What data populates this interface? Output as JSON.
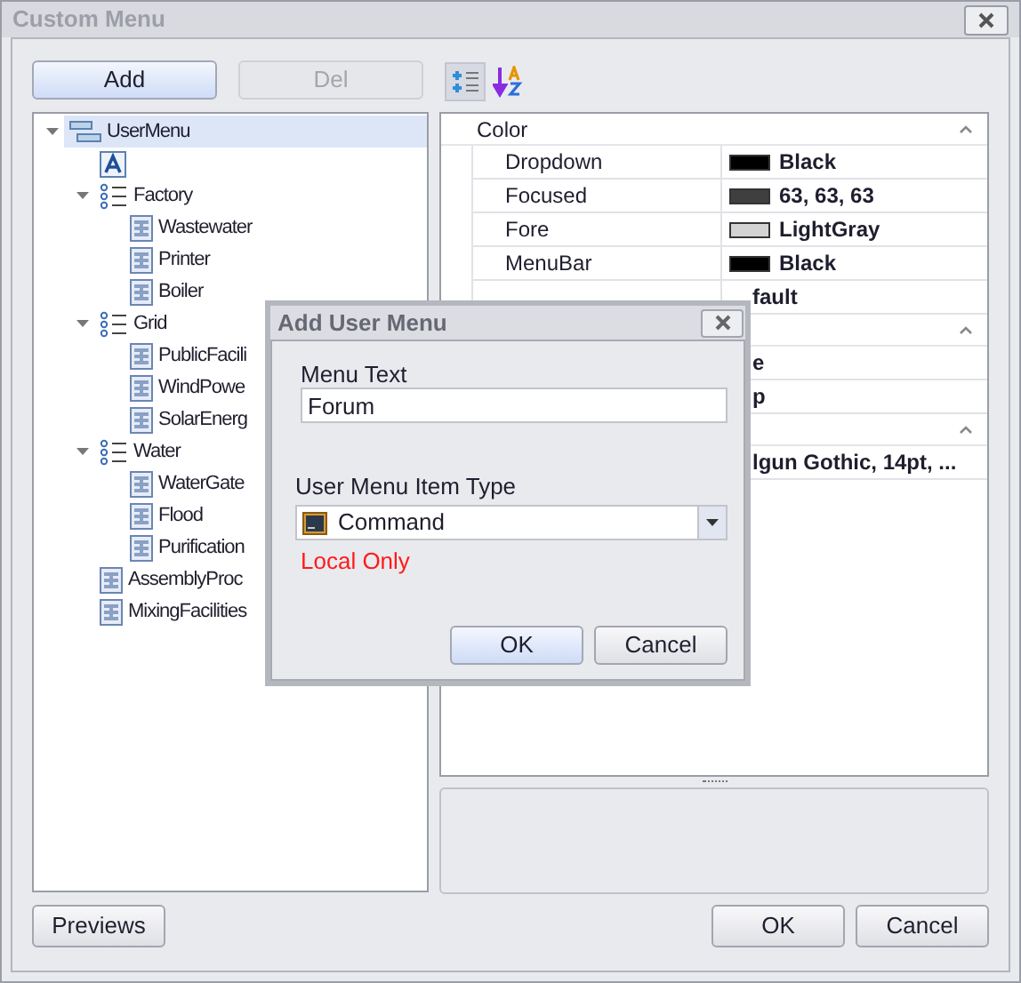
{
  "window": {
    "title": "Custom Menu"
  },
  "top_buttons": [
    {
      "label": "Add",
      "disabled": false,
      "focused": true
    },
    {
      "label": "Del",
      "disabled": true,
      "focused": false
    }
  ],
  "tree": [
    {
      "kind": "menu",
      "label": "UserMenu",
      "selected": true,
      "expanded": true,
      "children": [
        {
          "kind": "text",
          "selected": false
        },
        {
          "kind": "group",
          "label": "Factory",
          "selected": false,
          "expanded": true,
          "children": [
            {
              "kind": "item",
              "label": "Wastewater",
              "selected": false
            },
            {
              "kind": "item",
              "label": "Printer",
              "selected": false
            },
            {
              "kind": "item",
              "label": "Boiler",
              "selected": false
            }
          ]
        },
        {
          "kind": "group",
          "label": "Grid",
          "selected": false,
          "expanded": true,
          "children": [
            {
              "kind": "item",
              "label": "PublicFacili",
              "selected": false
            },
            {
              "kind": "item",
              "label": "WindPowe",
              "selected": false
            },
            {
              "kind": "item",
              "label": "SolarEnerg",
              "selected": false
            }
          ]
        },
        {
          "kind": "group",
          "label": "Water",
          "selected": false,
          "expanded": true,
          "children": [
            {
              "kind": "item",
              "label": "WaterGate",
              "selected": false
            },
            {
              "kind": "item",
              "label": "Flood",
              "selected": false
            },
            {
              "kind": "item",
              "label": "Purification",
              "selected": false
            }
          ]
        },
        {
          "kind": "item",
          "label": "AssemblyProc",
          "selected": false
        },
        {
          "kind": "item",
          "label": "MixingFacilities",
          "selected": false
        }
      ]
    }
  ],
  "property_grid": {
    "categories": [
      {
        "label": "Color",
        "expanded": true,
        "rows": [
          {
            "name": "Dropdown",
            "value": "Black",
            "color": "#000000"
          },
          {
            "name": "Focused",
            "value": "63, 63, 63",
            "color": "#3f3f3f"
          },
          {
            "name": "Fore",
            "value": "LightGray",
            "color": "#d3d3d3"
          },
          {
            "name": "MenuBar",
            "value": "Black",
            "color": "#000000"
          },
          {
            "value": "fault"
          }
        ]
      },
      {
        "expanded": true,
        "rows": [
          {
            "value": "e"
          },
          {
            "value": "p"
          }
        ]
      },
      {
        "expanded": true,
        "rows": [
          {
            "value": "lgun Gothic, 14pt, ..."
          }
        ]
      }
    ]
  },
  "bottom_buttons": [
    {
      "label": "Previews"
    },
    {
      "label": "OK"
    },
    {
      "label": "Cancel"
    }
  ],
  "dialog": {
    "title": "Add User Menu",
    "menu_text_label": "Menu Text",
    "menu_text_value": "Forum",
    "type_label": "User Menu Item Type",
    "type_value": "Command",
    "note": "Local Only",
    "buttons": [
      {
        "label": "OK",
        "focused": true
      },
      {
        "label": "Cancel",
        "focused": false
      }
    ]
  }
}
